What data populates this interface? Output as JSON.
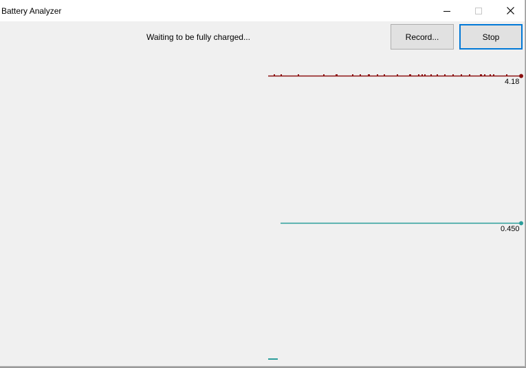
{
  "window": {
    "title": "Battery Analyzer"
  },
  "status": {
    "text": "Waiting to be fully charged..."
  },
  "toolbar": {
    "record_label": "Record...",
    "stop_label": "Stop"
  },
  "readouts": {
    "voltage": "4.18",
    "current": "0.450"
  },
  "colors": {
    "voltage_trace": "#8b1010",
    "current_trace": "#2a9d9a",
    "stop_focus": "#0078d7"
  },
  "icons": {
    "minimize": "minimize-icon",
    "maximize": "maximize-icon",
    "close": "close-icon"
  }
}
